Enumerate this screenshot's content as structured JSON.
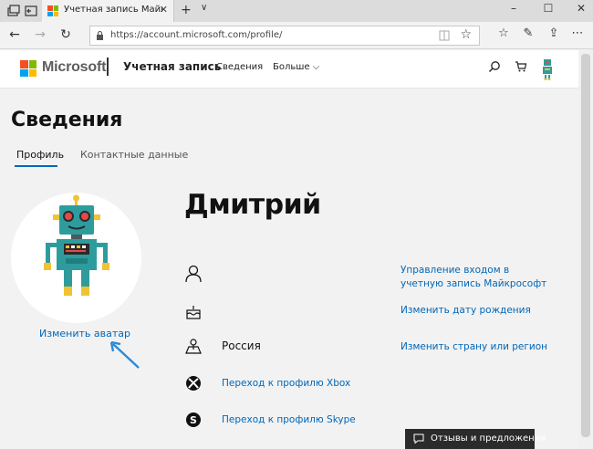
{
  "browser": {
    "tab_title": "Учетная запись Майкр",
    "url": "https://account.microsoft.com/profile/"
  },
  "header": {
    "brand": "Microsoft",
    "account_title": "Учетная запись",
    "nav_details": "Сведения",
    "nav_more": "Больше ⌵"
  },
  "page": {
    "title": "Сведения",
    "tabs": [
      "Профиль",
      "Контактные данные"
    ],
    "change_avatar": "Изменить аватар",
    "user_name": "Дмитрий",
    "country": "Россия",
    "links": {
      "manage_signin": "Управление входом в учетную запись Майкрософт",
      "change_birthday": "Изменить дату рождения",
      "change_country": "Изменить страну или регион",
      "xbox_profile": "Переход к профилю Xbox",
      "skype_profile": "Переход к профилю Skype"
    }
  },
  "feedback": {
    "label": "Отзывы и предложения"
  },
  "colors": {
    "link": "#0067b8",
    "ms_red": "#f25022",
    "ms_green": "#7fba00",
    "ms_blue": "#00a4ef",
    "ms_yellow": "#ffb900",
    "robot_teal": "#2e9c9d"
  }
}
